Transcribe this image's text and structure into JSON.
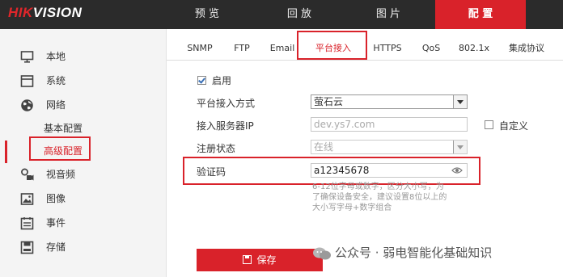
{
  "brand": {
    "red": "HIK",
    "white": "VISION"
  },
  "nav": {
    "tabs": [
      {
        "label": "预 览"
      },
      {
        "label": "回 放"
      },
      {
        "label": "图 片"
      },
      {
        "label": "配 置",
        "active": true
      }
    ]
  },
  "sidebar": {
    "items": [
      {
        "label": "本地",
        "icon": "monitor-icon"
      },
      {
        "label": "系统",
        "icon": "system-icon"
      },
      {
        "label": "网络",
        "icon": "globe-icon"
      },
      {
        "label": "视音频",
        "icon": "video-audio-icon"
      },
      {
        "label": "图像",
        "icon": "image-icon"
      },
      {
        "label": "事件",
        "icon": "event-icon"
      },
      {
        "label": "存储",
        "icon": "storage-icon"
      }
    ],
    "network_sub": [
      {
        "label": "基本配置"
      },
      {
        "label": "高级配置",
        "active": true
      }
    ]
  },
  "subtabs": [
    {
      "label": "SNMP"
    },
    {
      "label": "FTP"
    },
    {
      "label": "Email"
    },
    {
      "label": "平台接入",
      "active": true
    },
    {
      "label": "HTTPS"
    },
    {
      "label": "QoS"
    },
    {
      "label": "802.1x"
    },
    {
      "label": "集成协议"
    }
  ],
  "form": {
    "enable_label": "启用",
    "enable_checked": true,
    "access_mode_label": "平台接入方式",
    "access_mode_value": "萤石云",
    "server_ip_label": "接入服务器IP",
    "server_ip_value": "dev.ys7.com",
    "custom_label": "自定义",
    "register_status_label": "注册状态",
    "register_status_value": "在线",
    "verify_code_label": "验证码",
    "verify_code_value": "a12345678",
    "hint_line1": "6-12位字母或数字，区分大小写，为",
    "hint_line2": "了确保设备安全，建议设置8位以上的",
    "hint_line3": "大小写字母+数字组合"
  },
  "save_label": "保存",
  "watermark": "公众号 · 弱电智能化基础知识",
  "colors": {
    "accent": "#d9222a",
    "topbar": "#2b2b2b",
    "sidebar": "#f4f4f4"
  }
}
